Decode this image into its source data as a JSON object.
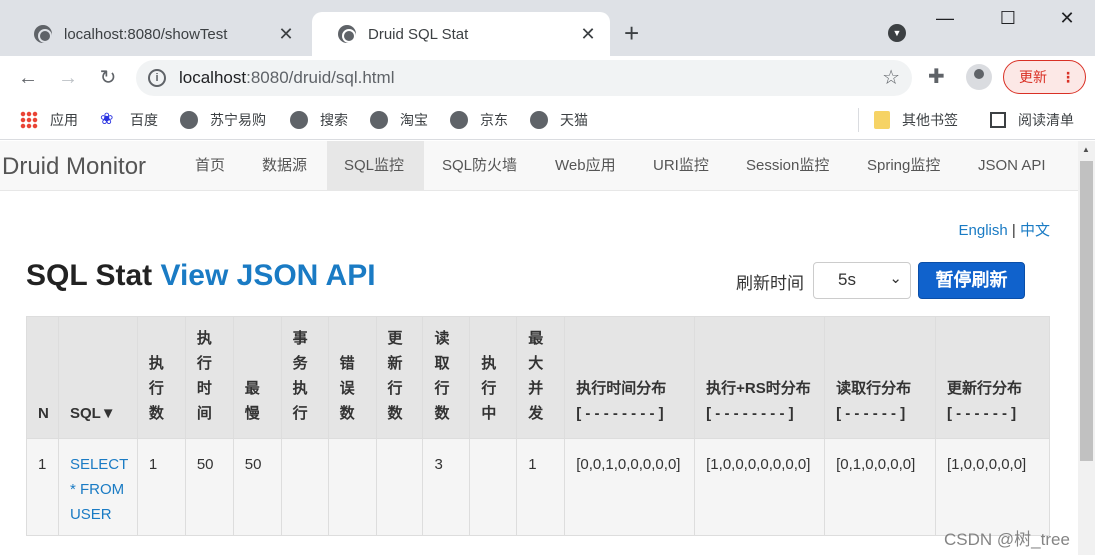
{
  "browser": {
    "tabs": [
      {
        "title": "localhost:8080/showTest",
        "close": "✕"
      },
      {
        "title": "Druid SQL Stat",
        "close": "✕"
      }
    ],
    "new_tab": "+",
    "url_host": "localhost",
    "url_rest": ":8080/druid/sql.html",
    "update_label": "更新",
    "bookmarks": [
      "应用",
      "百度",
      "苏宁易购",
      "搜索",
      "淘宝",
      "京东",
      "天猫",
      "其他书签",
      "阅读清单"
    ]
  },
  "navbar": {
    "brand": "Druid Monitor",
    "items": [
      "首页",
      "数据源",
      "SQL监控",
      "SQL防火墙",
      "Web应用",
      "URI监控",
      "Session监控",
      "Spring监控",
      "JSON API"
    ]
  },
  "lang": {
    "en": "English",
    "sep": "|",
    "zh": "中文"
  },
  "heading": {
    "title": "SQL Stat",
    "link": "View JSON API"
  },
  "refresh": {
    "label": "刷新时间",
    "value": "5s",
    "pause": "暂停刷新"
  },
  "table": {
    "headers": [
      "N",
      "SQL▼",
      "执行数",
      "执行时间",
      "最慢",
      "事务执行",
      "错误数",
      "更新行数",
      "读取行数",
      "执行中",
      "最大并发",
      "执行时间分布\n[ - - - - - - - - ]",
      "执行+RS时分布\n[ - - - - - - - - ]",
      "读取行分布\n[ - - - - - - ]",
      "更新行分布\n[ - - - - - - ]"
    ],
    "rows": [
      [
        "1",
        "SELECT * FROM USER",
        "1",
        "50",
        "50",
        "",
        "",
        "",
        "3",
        "",
        "1",
        "[0,0,1,0,0,0,0,0]",
        "[1,0,0,0,0,0,0,0]",
        "[0,1,0,0,0,0]",
        "[1,0,0,0,0,0]"
      ]
    ]
  },
  "watermark": "CSDN @树_tree"
}
